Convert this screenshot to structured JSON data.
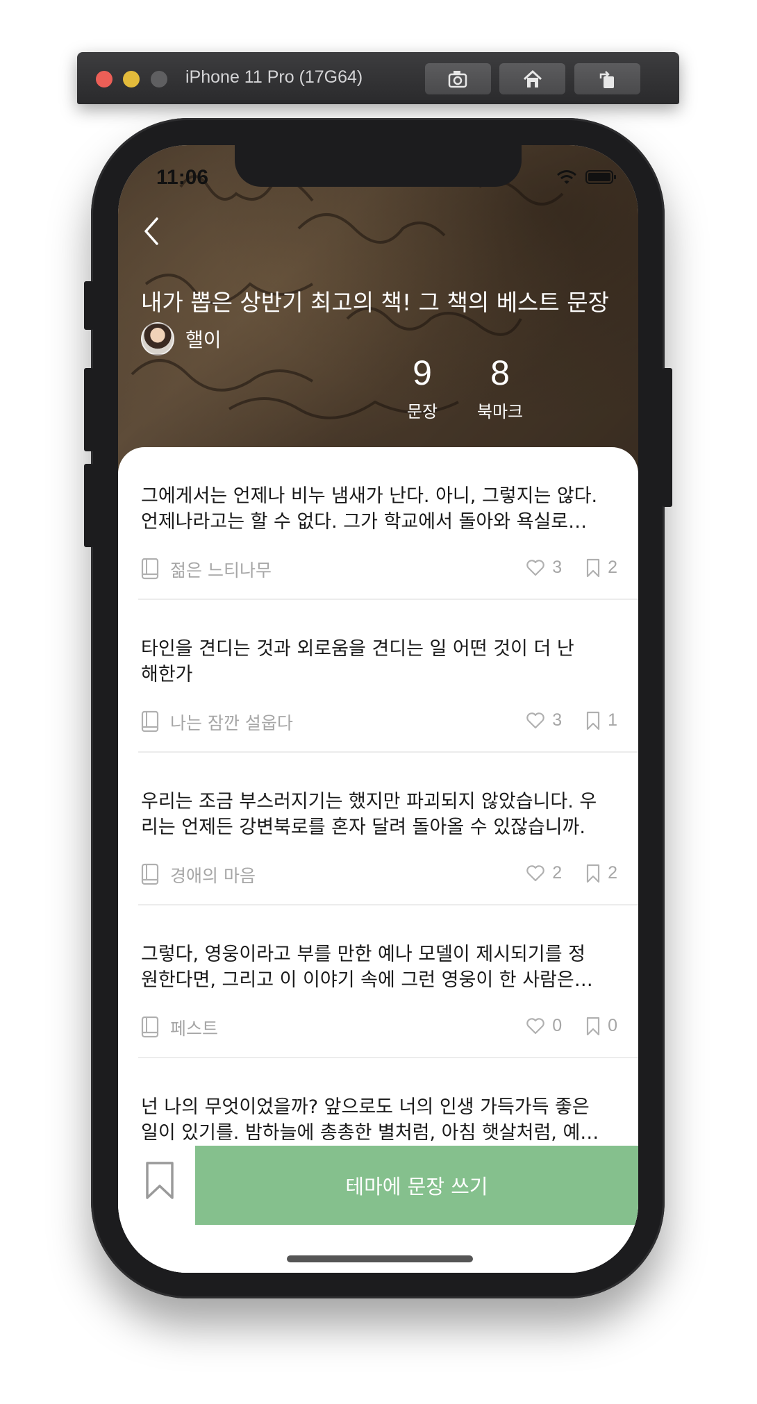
{
  "simulator": {
    "title": "iPhone 11 Pro (17G64)",
    "buttons": [
      {
        "icon": "screenshot-icon"
      },
      {
        "icon": "home-icon"
      },
      {
        "icon": "rotate-icon"
      }
    ]
  },
  "status_bar": {
    "time": "11:06",
    "icons": [
      "wifi-icon",
      "battery-icon"
    ]
  },
  "header": {
    "back_icon": "chevron-left-icon",
    "title": "내가 뽑은 상반기 최고의 책! 그 책의 베스트 문장",
    "author": "핼이",
    "stats": [
      {
        "value": "9",
        "label": "문장"
      },
      {
        "value": "8",
        "label": "북마크"
      }
    ]
  },
  "sentences": [
    {
      "text": "그에게서는 언제나 비누 냄새가 난다. 아니, 그렇지는 않다.\n언제나라고는 할 수 없다. 그가 학교에서 돌아와 욕실로…",
      "book": "젊은 느티나무",
      "likes": "3",
      "bookmarks": "2"
    },
    {
      "text": "타인을 견디는 것과 외로움을 견디는 일 어떤 것이 더 난\n해한가",
      "book": "나는 잠깐 설웁다",
      "likes": "3",
      "bookmarks": "1"
    },
    {
      "text": "우리는 조금 부스러지기는 했지만 파괴되지 않았습니다. 우\n리는 언제든 강변북로를 혼자 달려 돌아올 수 있잖습니까.",
      "book": "경애의 마음",
      "likes": "2",
      "bookmarks": "2"
    },
    {
      "text": "그렇다, 영웅이라고 부를 만한 예나 모델이 제시되기를 정\n원한다면, 그리고 이 이야기 속에 그런 영웅이 한 사람은…",
      "book": "페스트",
      "likes": "0",
      "bookmarks": "0"
    },
    {
      "text": "넌 나의 무엇이었을까? 앞으로도 너의 인생 가득가득 좋은\n일이 있기를. 밤하늘에 총총한 별처럼, 아침 햇살처럼, 예…",
      "book": "",
      "likes": "",
      "bookmarks": ""
    }
  ],
  "bottom_bar": {
    "bookmark_icon": "bookmark-icon",
    "write_label": "테마에 문장 쓰기"
  },
  "colors": {
    "accent": "#85c08d",
    "meta_text": "#a6a6a6"
  }
}
